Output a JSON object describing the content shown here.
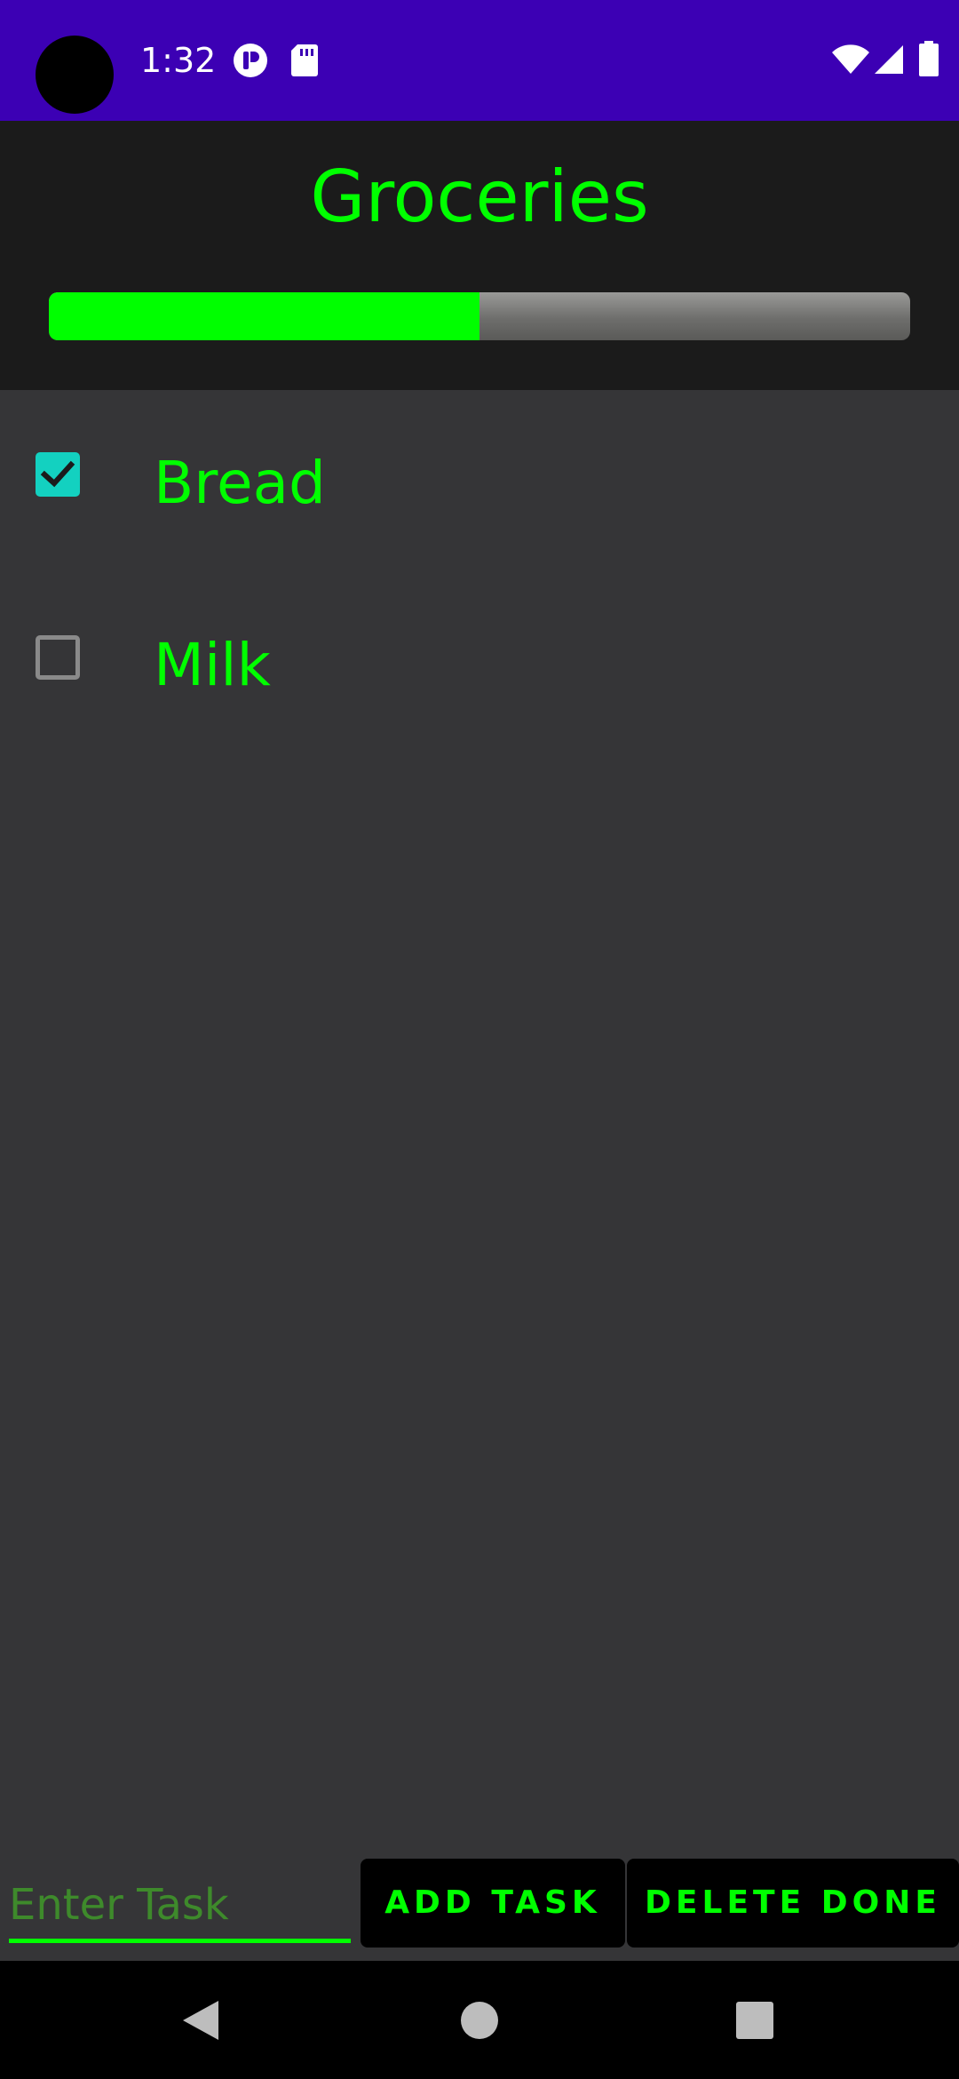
{
  "status_bar": {
    "time": "1:32",
    "bg_color": "#3c00b4",
    "left_icons": [
      "notification-app-icon",
      "sd-card-icon"
    ],
    "right_icons": [
      "wifi-icon",
      "cellular-signal-icon",
      "battery-icon"
    ]
  },
  "header": {
    "title": "Groceries",
    "progress_fraction": 0.5,
    "accent_color": "#00ff00"
  },
  "tasks": [
    {
      "label": "Bread",
      "checked": true
    },
    {
      "label": "Milk",
      "checked": false
    }
  ],
  "bottom_bar": {
    "input_placeholder": "Enter Task",
    "input_value": "",
    "add_task_label": "ADD TASK",
    "delete_done_label": "DELETE DONE"
  },
  "nav_bar": {
    "buttons": [
      "back-icon",
      "home-icon",
      "recents-icon"
    ]
  }
}
